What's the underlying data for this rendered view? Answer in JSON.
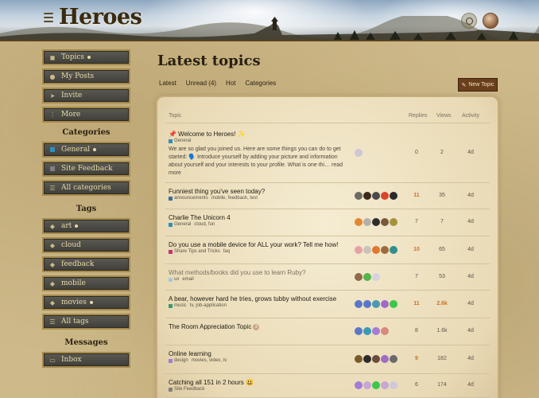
{
  "header": {
    "logo": "Heroes",
    "search_icon": "search-icon",
    "avatar": "user-avatar"
  },
  "sidebar": {
    "top": [
      {
        "label": "Topics",
        "icon": "layer-icon",
        "dot": true
      },
      {
        "label": "My Posts",
        "icon": "user-icon"
      },
      {
        "label": "Invite",
        "icon": "paper-plane-icon"
      },
      {
        "label": "More",
        "icon": "vertical-ellipsis-icon"
      }
    ],
    "categories_heading": "Categories",
    "categories": [
      {
        "label": "General",
        "color": "#2f8fb8",
        "dot": true
      },
      {
        "label": "Site Feedback",
        "color": "#808080"
      },
      {
        "label": "All categories",
        "icon": "list-icon"
      }
    ],
    "tags_heading": "Tags",
    "tags": [
      {
        "label": "art",
        "dot": true
      },
      {
        "label": "cloud"
      },
      {
        "label": "feedback"
      },
      {
        "label": "mobile"
      },
      {
        "label": "movies",
        "dot": true
      },
      {
        "label": "All tags",
        "icon": "list-icon"
      }
    ],
    "messages_heading": "Messages",
    "messages": [
      {
        "label": "Inbox",
        "icon": "inbox-icon"
      }
    ]
  },
  "main": {
    "title": "Latest topics",
    "tabs": [
      "Latest",
      "Unread (4)",
      "Hot",
      "Categories"
    ],
    "new_topic": "New Topic",
    "columns": {
      "topic": "Topic",
      "replies": "Replies",
      "views": "Views",
      "activity": "Activity"
    },
    "topics": [
      {
        "title": "📌 Welcome to Heroes! ✨",
        "category": "General",
        "cat_color": "#2f8fb8",
        "tags": "",
        "excerpt": "We are so glad you joined us. Here are some things you can do to get started: 🗣️ Introduce yourself by adding your picture and information about yourself and your interests to your profile. What is one thi… read more",
        "replies": "0",
        "views": "2",
        "activity": "4d",
        "posters": [
          "#cfc6d6"
        ]
      },
      {
        "title": "Funniest thing you've seen today?",
        "category": "announcements",
        "cat_color": "#3a6e99",
        "tags": "mobile, feedback, test",
        "replies": "11",
        "replies_hot": true,
        "views": "35",
        "activity": "4d",
        "posters": [
          "#6d6a64",
          "#3a2a1a",
          "#4a4a4a",
          "#d9462c",
          "#2a2a2a"
        ]
      },
      {
        "title": "Charlie The Unicorn 4",
        "category": "General",
        "cat_color": "#2f8fb8",
        "tags": "cloud, fun",
        "replies": "7",
        "views": "7",
        "activity": "4d",
        "posters": [
          "#e2892d",
          "#b7b0a9",
          "#2d2d2d",
          "#7a5a3a",
          "#a4943a"
        ]
      },
      {
        "title": "Do you use a mobile device for ALL your work? Tell me how!",
        "category": "Share Tips and Tricks",
        "cat_color": "#c8326d",
        "tags": "faq",
        "replies": "10",
        "replies_hot": true,
        "views": "65",
        "activity": "4d",
        "posters": [
          "#e7a0a8",
          "#c8c2b8",
          "#e0782d",
          "#9d6b3a",
          "#2f8f8f"
        ]
      },
      {
        "title": "What methods/books did you use to learn Ruby?",
        "title_muted": true,
        "category": "ux",
        "cat_color": "#a7c7d9",
        "tags": "email",
        "replies": "7",
        "views": "53",
        "activity": "4d",
        "posters": [
          "#8c6a4a",
          "#52b54a",
          "#d8d2e0"
        ]
      },
      {
        "title": "A bear, however hard he tries, grows tubby without exercise",
        "category": "music",
        "cat_color": "#3d9b74",
        "tags": "tv, job-application",
        "replies": "11",
        "replies_hot": true,
        "views": "2.6k",
        "views_hot": true,
        "activity": "4d",
        "posters": [
          "#5a78c7",
          "#5a78c7",
          "#4a9ab4",
          "#a06bc7",
          "#3ac74a"
        ]
      },
      {
        "title": "The Room Appreciation Topic",
        "badge": "2",
        "category": "",
        "cat_color": "",
        "tags": "",
        "replies": "8",
        "views": "1.6k",
        "activity": "4d",
        "posters": [
          "#5a78c7",
          "#3a9ab4",
          "#a47bd6",
          "#d78a7a"
        ]
      },
      {
        "title": "Online learning",
        "category": "design",
        "cat_color": "#a47bd6",
        "tags": "movies, video, tv",
        "replies": "9",
        "replies_hot": true,
        "views": "182",
        "activity": "4d",
        "posters": [
          "#7a5a2a",
          "#2a2a2a",
          "#6a4a3a",
          "#a06bc7",
          "#6a6a6a"
        ]
      },
      {
        "title": "Catching all 151 in 2 hours 😃",
        "category": "Site Feedback",
        "cat_color": "#808080",
        "tags": "",
        "replies": "6",
        "views": "174",
        "activity": "4d",
        "posters": [
          "#a47bd6",
          "#c7a7d6",
          "#3ac74a",
          "#c7a7d6",
          "#d0cad8"
        ]
      }
    ]
  }
}
